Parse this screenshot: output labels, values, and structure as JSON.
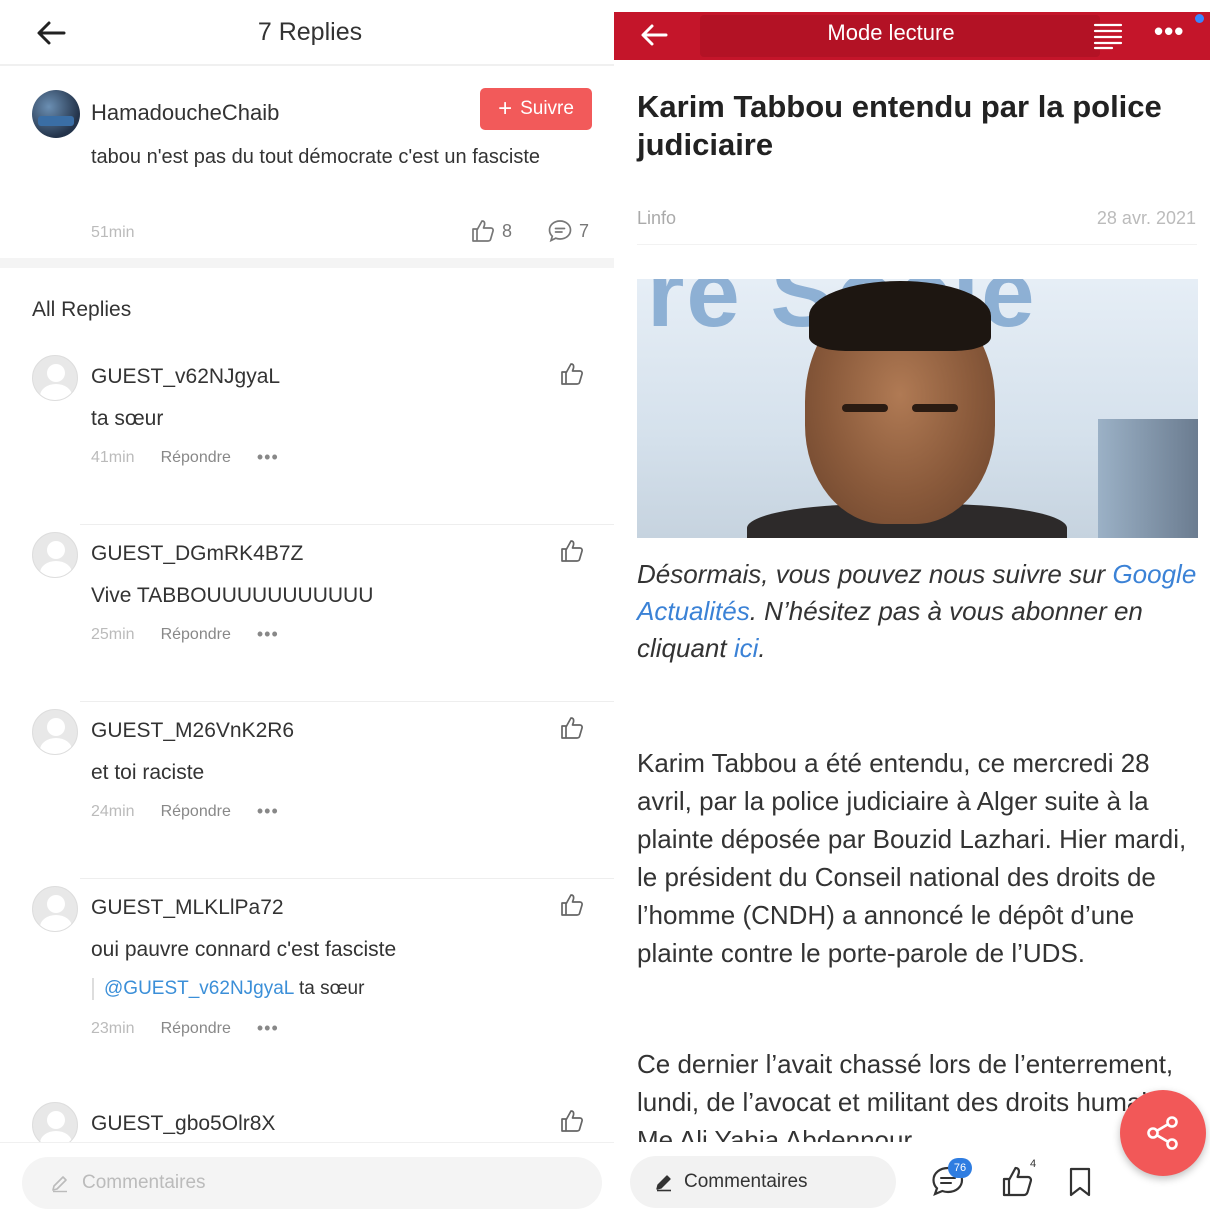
{
  "left": {
    "header": {
      "title": "7 Replies"
    },
    "post": {
      "username": "HamadoucheChaib",
      "follow_label": "Suivre",
      "text": "tabou n'est pas du tout démocrate c'est un fasciste",
      "time": "51min",
      "likes": "8",
      "comments": "7"
    },
    "all_replies_label": "All Replies",
    "replies": [
      {
        "username": "GUEST_v62NJgyaL",
        "text": "ta sœur",
        "time": "41min",
        "reply_label": "Répondre",
        "more": "•••"
      },
      {
        "username": "GUEST_DGmRK4B7Z",
        "text": "Vive TABBOUUUUUUUUUUU",
        "time": "25min",
        "reply_label": "Répondre",
        "more": "•••"
      },
      {
        "username": "GUEST_M26VnK2R6",
        "text": "et toi raciste",
        "time": "24min",
        "reply_label": "Répondre",
        "more": "•••"
      },
      {
        "username": "GUEST_MLKLlPa72",
        "text": "oui pauvre connard c'est fasciste",
        "quote_mention": "@GUEST_v62NJgyaL",
        "quote_text": "ta sœur",
        "time": "23min",
        "reply_label": "Répondre",
        "more": "•••"
      },
      {
        "username": "GUEST_gbo5Olr8X"
      }
    ],
    "comment_placeholder": "Commentaires"
  },
  "right": {
    "topbar": {
      "mode_label": "Mode lecture",
      "more": "•••"
    },
    "article": {
      "headline": "Karim Tabbou entendu par la police judiciaire",
      "source": "Linfo",
      "date": "28 avr. 2021",
      "photo_text": "re Socie",
      "caption_1": "Désormais, vous pouvez nous suivre sur ",
      "caption_link_1": "Google Actualités",
      "caption_2": ". N’hésitez pas à vous abonner en cliquant ",
      "caption_link_2": "ici",
      "caption_3": ".",
      "body_1": "Karim Tabbou a été entendu, ce mercredi 28 avril, par la police judiciaire à Alger suite à la plainte déposée par Bouzid Lazhari. Hier mardi, le président du Conseil national des droits de l’homme (CNDH) a annoncé le dépôt d’une plainte contre le porte-parole de l’UDS.",
      "body_2": "Ce dernier l’avait chassé lors de l’enterrement, lundi, de l’avocat et militant des droits humains, Me Ali Yahia Abdennour"
    },
    "bottom": {
      "comment_label": "Commentaires",
      "comment_badge": "76",
      "like_count": "4"
    }
  },
  "colors": {
    "accent_red": "#c4152a",
    "follow_red": "#f25a5a",
    "link_blue": "#3b82d6",
    "mention_blue": "#3b8fd8"
  },
  "icons": [
    "back-arrow-icon",
    "thumbs-up-icon",
    "comment-bubble-icon",
    "pencil-icon",
    "reader-mode-icon",
    "more-dots-icon",
    "chat-icon",
    "bookmark-icon",
    "share-icon",
    "avatar-placeholder-icon"
  ]
}
